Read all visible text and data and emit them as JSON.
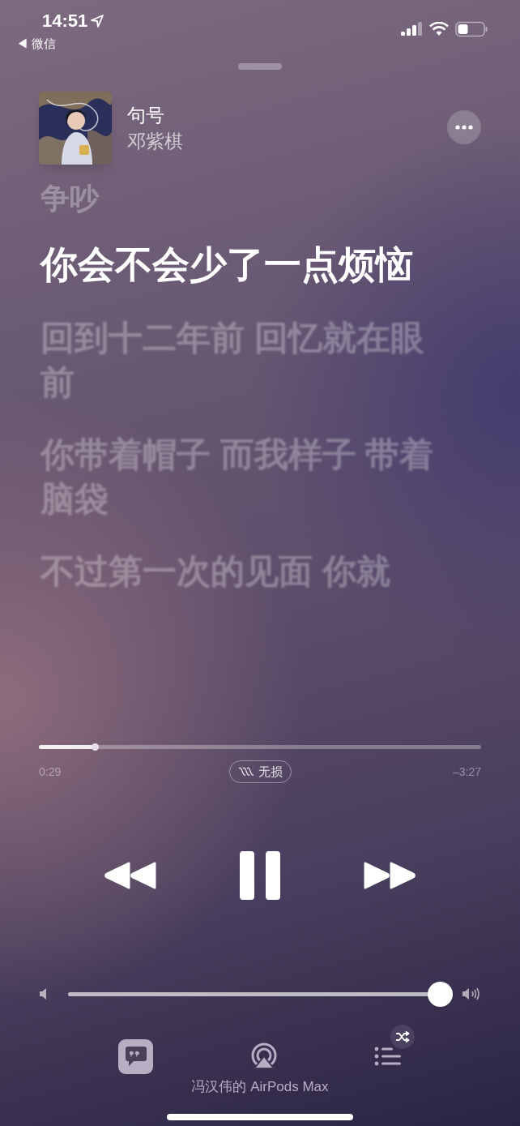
{
  "status_bar": {
    "time": "14:51",
    "back_app": "◀ 微信"
  },
  "now_playing": {
    "title": "句号",
    "artist": "邓紫棋"
  },
  "lyrics": [
    {
      "text": "争吵",
      "selected": false
    },
    {
      "text": "你会不会少了一点烦恼",
      "selected": true
    },
    {
      "text": "回到十二年前 回忆就在眼前",
      "selected": false
    },
    {
      "text": "你带着帽子 而我样子 带着脑袋",
      "selected": false
    },
    {
      "text": "不过第一次的见面 你就",
      "selected": false
    }
  ],
  "progress": {
    "level": 0.126,
    "elapsed": "0:29",
    "remaining": "–3:27",
    "badge": "无损"
  },
  "volume": {
    "level": 1
  },
  "playback": {
    "playing": true
  },
  "airplay": {
    "device": "冯汉伟的 AirPods Max"
  },
  "queue": {
    "shuffle": true
  }
}
